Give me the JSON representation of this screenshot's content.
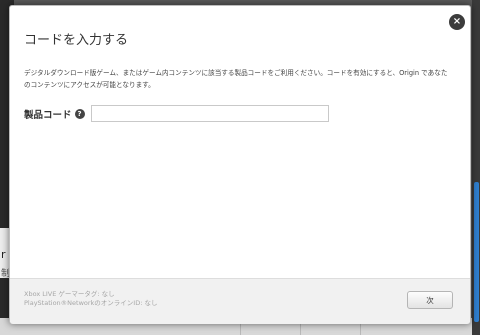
{
  "modal": {
    "title": "コードを入力する",
    "description": "デジタルダウンロード版ゲーム、またはゲーム内コンテンツに該当する製品コードをご利用ください。コードを有効にすると、Origin であなたのコンテンツにアクセスが可能となります。",
    "close_label": "×",
    "field": {
      "label": "製品コード",
      "help_icon": "?",
      "value": "",
      "placeholder": ""
    },
    "footer": {
      "xbox_info": "Xbox LIVE ゲーマータグ: なし",
      "psn_info": "PlayStation®NetworkのオンラインID: なし",
      "next_label": "次"
    }
  },
  "background": {
    "left_glyph": "r",
    "left_glyph2": "制"
  },
  "colors": {
    "scroll_accent": "#2f7fd0",
    "modal_bg": "#ffffff",
    "footer_bg": "#f1f1f1"
  }
}
